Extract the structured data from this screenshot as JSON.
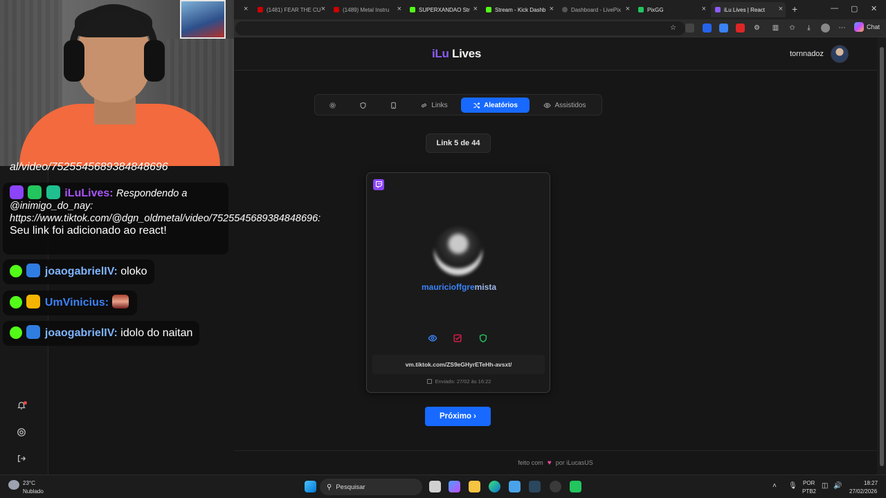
{
  "browser": {
    "tabs": [
      {
        "label": "(1481) FEAR THE CU",
        "color": "#cc0000"
      },
      {
        "label": "(1489) Metal Instru",
        "color": "#cc0000"
      },
      {
        "label": "SUPERXANDAO Str",
        "color": "#53fc18"
      },
      {
        "label": "Stream - Kick Dashb",
        "color": "#53fc18"
      },
      {
        "label": "Dashboard - LivePix",
        "color": "#555555"
      },
      {
        "label": "PixGG",
        "color": "#22c55e"
      },
      {
        "label": "iLu Lives | React",
        "color": "#8b5cf6",
        "active": true
      }
    ],
    "new_tab": "+",
    "close_glyph": "×",
    "window_controls": [
      "—",
      "▢",
      "✕"
    ],
    "chat_button": "Chat"
  },
  "app": {
    "logo_part1": "iLu",
    "logo_part2": "Lives",
    "username": "tornnadoz",
    "nav": {
      "links_label": "Links",
      "random_label": "Aleatórios",
      "watched_label": "Assistidos"
    },
    "counter": "Link 5 de 44",
    "card": {
      "platform": "twitch-icon",
      "username_part1": "mauricioffgre",
      "username_part2": "mista",
      "link": "vm.tiktok.com/ZS9eGHyrETeHh-avsxt/",
      "sent": "Enviado: 27/02 às 16:22"
    },
    "next_button": "Próximo ›",
    "footer": {
      "before": "feito com",
      "heart": "♥",
      "after": "por iLucasUS"
    }
  },
  "chat": {
    "overflow_text": "al/video/7525545689384848696",
    "messages": [
      {
        "user": "iLuLives:",
        "user_color": "#a855f7",
        "prefix": "Respondendo a @inimigo_do_nay: https://www.tiktok.com/@dgn_oldmetal/video/7525545689384848696:",
        "text": "Seu link foi adicionado ao react!"
      },
      {
        "user": "joaogabrielIV:",
        "user_color": "#7fb5ff",
        "text": "oloko"
      },
      {
        "user": "UmVinicius:",
        "user_color": "#3b82f6",
        "text": ""
      },
      {
        "user": "joaogabrielIV:",
        "user_color": "#7fb5ff",
        "text": "idolo do naitan"
      }
    ]
  },
  "taskbar": {
    "weather_temp": "23°C",
    "weather_desc": "Nublado",
    "search_placeholder": "Pesquisar",
    "lang": "POR",
    "layout": "PTB2",
    "time": "18:27",
    "date": "27/02/2026"
  }
}
